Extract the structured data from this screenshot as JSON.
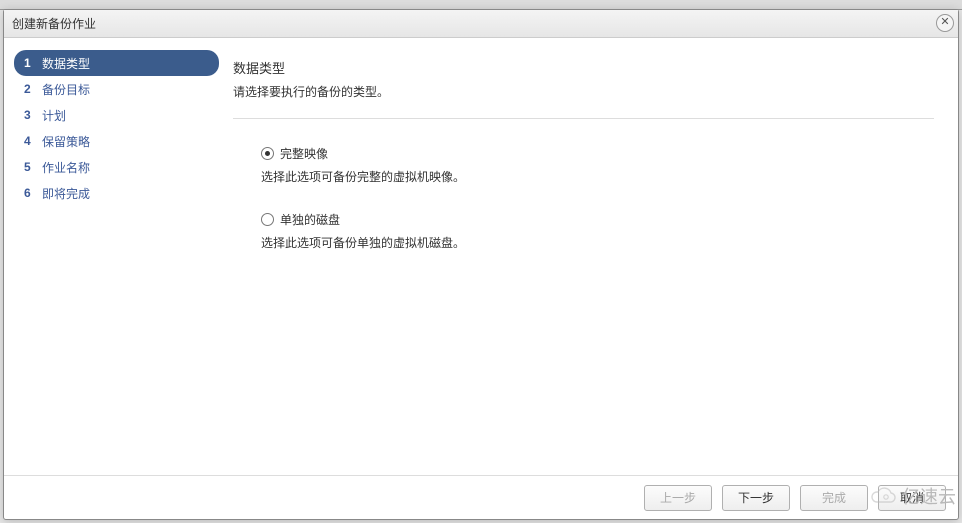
{
  "dialog": {
    "title": "创建新备份作业"
  },
  "sidebar": {
    "steps": [
      {
        "num": "1",
        "label": "数据类型"
      },
      {
        "num": "2",
        "label": "备份目标"
      },
      {
        "num": "3",
        "label": "计划"
      },
      {
        "num": "4",
        "label": "保留策略"
      },
      {
        "num": "5",
        "label": "作业名称"
      },
      {
        "num": "6",
        "label": "即将完成"
      }
    ]
  },
  "main": {
    "heading": "数据类型",
    "subheading": "请选择要执行的备份的类型。",
    "options": [
      {
        "label": "完整映像",
        "desc": "选择此选项可备份完整的虚拟机映像。",
        "checked": true
      },
      {
        "label": "单独的磁盘",
        "desc": "选择此选项可备份单独的虚拟机磁盘。",
        "checked": false
      }
    ]
  },
  "footer": {
    "prev": "上一步",
    "next": "下一步",
    "finish": "完成",
    "cancel": "取消"
  },
  "watermark": "亿速云"
}
